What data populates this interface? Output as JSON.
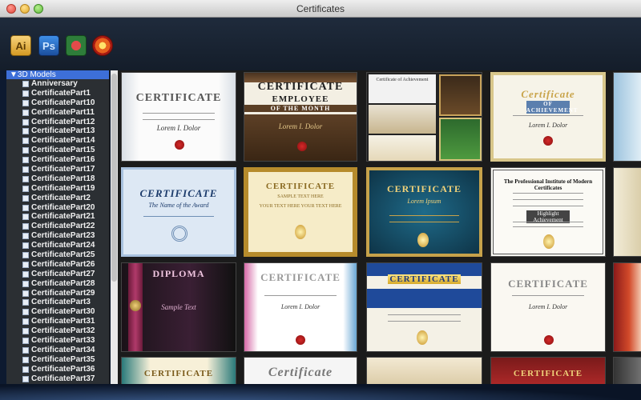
{
  "window": {
    "title": "Certificates"
  },
  "toolbar": {
    "buttons": [
      {
        "icon": "illustrator-icon",
        "label": "Ai"
      },
      {
        "icon": "photoshop-icon",
        "label": "Ps"
      },
      {
        "icon": "poker-chip-icon",
        "label": ""
      },
      {
        "icon": "lens-icon",
        "label": ""
      }
    ]
  },
  "sidebar": {
    "header": "▼3D Models",
    "items": [
      "Anniversary",
      "CertificatePart1",
      "CertificatePart10",
      "CertificatePart11",
      "CertificatePart12",
      "CertificatePart13",
      "CertificatePart14",
      "CertificatePart15",
      "CertificatePart16",
      "CertificatePart17",
      "CertificatePart18",
      "CertificatePart19",
      "CertificatePart2",
      "CertificatePart20",
      "CertificatePart21",
      "CertificatePart22",
      "CertificatePart23",
      "CertificatePart24",
      "CertificatePart25",
      "CertificatePart26",
      "CertificatePart27",
      "CertificatePart28",
      "CertificatePart29",
      "CertificatePart3",
      "CertificatePart30",
      "CertificatePart31",
      "CertificatePart32",
      "CertificatePart33",
      "CertificatePart34",
      "CertificatePart35",
      "CertificatePart36",
      "CertificatePart37"
    ]
  },
  "thumbnails": {
    "t1": {
      "title": "CERTIFICATE",
      "sub": "Lorem I. Dolor"
    },
    "t2": {
      "title": "CERTIFICATE",
      "line2": "EMPLOYEE",
      "line3": "OF THE MONTH",
      "sub": "Lorem I. Dolor"
    },
    "t3": {
      "title": "Certificate of Achievement"
    },
    "t4": {
      "title": "Certificate",
      "line2": "OF ACHIEVEMENT",
      "sub": "Lorem I. Dolor"
    },
    "t6": {
      "title": "CERTIFICATE",
      "sub": "The Name of the Award"
    },
    "t7": {
      "title": "CERTIFICATE",
      "line2": "SAMPLE TEXT HERE",
      "line3": "YOUR TEXT HERE YOUR TEXT HERE"
    },
    "t8": {
      "title": "CERTIFICATE",
      "sub": "Lorem Ipsum"
    },
    "t9": {
      "title": "The Professional Institute of Modern Certificates",
      "sub": "Highlight Achievement"
    },
    "t11": {
      "title": "DIPLOMA",
      "sub": "Sample Text"
    },
    "t12": {
      "title": "CERTIFICATE",
      "sub": "Lorem I. Dolor"
    },
    "t13": {
      "title": "CERTIFICATE"
    },
    "t14": {
      "title": "CERTIFICATE",
      "sub": "Lorem I. Dolor"
    },
    "t16": {
      "title": "CERTIFICATE"
    },
    "t17": {
      "title": "Certificate"
    },
    "t18": {
      "title": "CERTIFICATE"
    }
  }
}
